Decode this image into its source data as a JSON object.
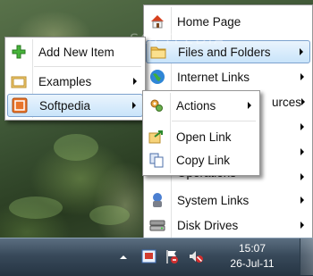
{
  "main_menu": {
    "items": [
      {
        "label": "Home Page",
        "icon": "home-icon",
        "submenu": false
      },
      {
        "label": "Files and Folders",
        "icon": "folder-icon",
        "submenu": true,
        "highlighted": true
      },
      {
        "label": "Internet Links",
        "icon": "globe-icon",
        "submenu": true
      },
      {
        "label": "urces",
        "icon": "resources-icon",
        "submenu": true
      },
      {
        "label": "",
        "icon": "blank",
        "submenu": true
      },
      {
        "label": "",
        "icon": "blank",
        "submenu": true
      },
      {
        "label": "Operations",
        "icon": "operations-icon",
        "submenu": true
      },
      {
        "label": "System Links",
        "icon": "system-icon",
        "submenu": true
      },
      {
        "label": "Disk Drives",
        "icon": "disk-icon",
        "submenu": true
      }
    ]
  },
  "left_menu": {
    "items": [
      {
        "label": "Add New Item",
        "icon": "plus-icon",
        "submenu": false
      },
      {
        "label": "Examples",
        "icon": "examples-icon",
        "submenu": true
      },
      {
        "label": "Softpedia",
        "icon": "softpedia-icon",
        "submenu": true,
        "highlighted": true
      }
    ]
  },
  "actions_menu": {
    "items": [
      {
        "label": "Actions",
        "icon": "gears-icon",
        "submenu": true
      },
      {
        "label": "Open Link",
        "icon": "open-link-icon",
        "submenu": false
      },
      {
        "label": "Copy Link",
        "icon": "copy-link-icon",
        "submenu": false
      }
    ]
  },
  "taskbar": {
    "time": "15:07",
    "date": "26-Jul-11"
  },
  "watermark": "SOFTPEDIA",
  "colors": {
    "highlight_border": "#7da2ce",
    "highlight_fill": "#c9e4fa",
    "menu_bg": "#ffffff"
  }
}
